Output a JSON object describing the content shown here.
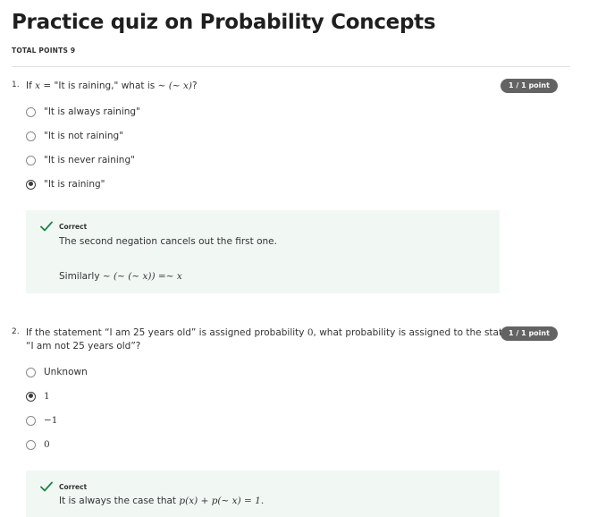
{
  "page": {
    "title": "Practice quiz on Probability Concepts",
    "total_points": "TOTAL POINTS 9"
  },
  "questions": [
    {
      "number": "1.",
      "text_pre": "If ",
      "text_math1": "x",
      "text_mid": " = \"It is raining,\" what is ",
      "text_math2": "∼ (∼ x)",
      "text_post": "?",
      "score": "1 / 1 point",
      "options": [
        {
          "label": "\"It is always raining\"",
          "selected": false
        },
        {
          "label": "\"It is not raining\"",
          "selected": false
        },
        {
          "label": "\"It is never raining\"",
          "selected": false
        },
        {
          "label": "\"It is raining\"",
          "selected": true
        }
      ],
      "feedback": {
        "status": "Correct",
        "line1": "The second negation cancels out the first one.",
        "line2_pre": "Similarly ",
        "line2_math": "∼ (∼ (∼ x)) =∼ x"
      }
    },
    {
      "number": "2.",
      "text_line1_pre": "If the statement “I am 25 years old” is assigned probability ",
      "text_line1_math": "0",
      "text_line1_post": ", what probability is assigned to the statement",
      "text_line2": "“I am not 25 years old”?",
      "score": "1 / 1 point",
      "options": [
        {
          "label": "Unknown",
          "selected": false
        },
        {
          "label": "1",
          "selected": true
        },
        {
          "label": "−1",
          "selected": false
        },
        {
          "label": "0",
          "selected": false
        }
      ],
      "feedback": {
        "status": "Correct",
        "line1_pre": "It is always the case that ",
        "line1_math": "p(x) + p(∼ x) = 1."
      }
    }
  ],
  "colors": {
    "badge_bg": "#636363",
    "feedback_bg": "#f1f8f4",
    "check_green": "#1e8449"
  }
}
